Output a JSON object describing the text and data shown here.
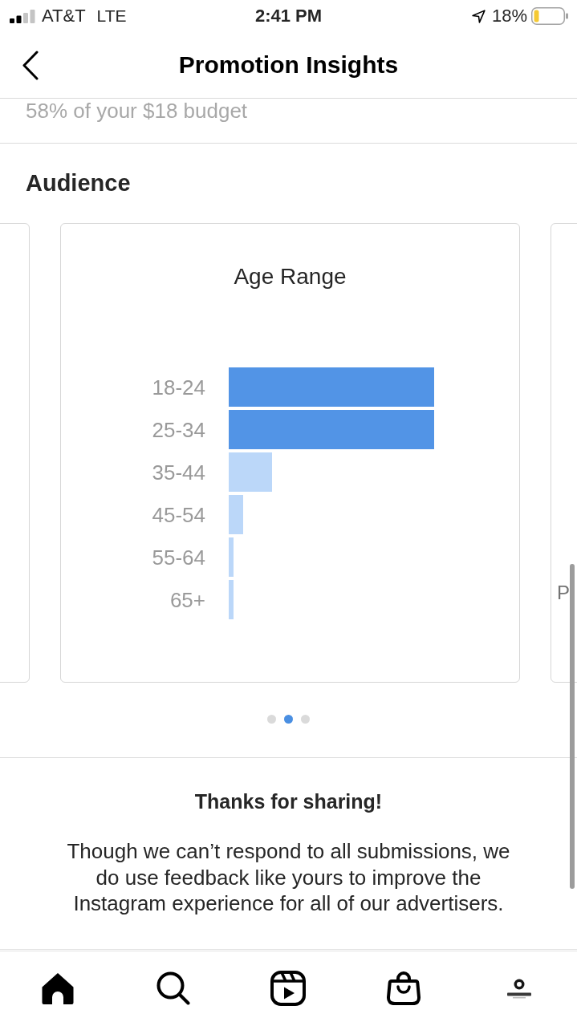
{
  "status_bar": {
    "carrier": "AT&T",
    "network": "LTE",
    "time": "2:41 PM",
    "battery": "18%"
  },
  "header": {
    "title": "Promotion Insights"
  },
  "budget_note": "58% of your $18 budget",
  "audience": {
    "heading": "Audience",
    "cards": [
      {
        "kind": "edge"
      },
      {
        "kind": "chart",
        "title": "Age Range",
        "rows": [
          {
            "label": "18-24",
            "color": "#5294e6"
          },
          {
            "label": "25-34",
            "color": "#5294e6"
          },
          {
            "label": "35-44",
            "color": "#bbd7f9"
          },
          {
            "label": "45-54",
            "color": "#bbd7f9"
          },
          {
            "label": "55-64",
            "color": "#bbd7f9"
          },
          {
            "label": "65+",
            "color": "#bbd7f9"
          }
        ]
      },
      {
        "kind": "edge",
        "text": "P"
      }
    ],
    "pages": [
      {
        "selected": false
      },
      {
        "selected": true
      },
      {
        "selected": false
      }
    ]
  },
  "feedback": {
    "title": "Thanks for sharing!",
    "message": "Though we can’t respond to all submissions, we do use feedback like yours to improve the Instagram experience for all of our advertisers."
  },
  "tab_bar": {
    "tabs": [
      {
        "kind": "home",
        "selected": true
      },
      {
        "kind": "search",
        "selected": false
      },
      {
        "kind": "reels",
        "selected": false
      },
      {
        "kind": "shop",
        "selected": false
      },
      {
        "kind": "profile",
        "selected": false
      }
    ]
  }
}
